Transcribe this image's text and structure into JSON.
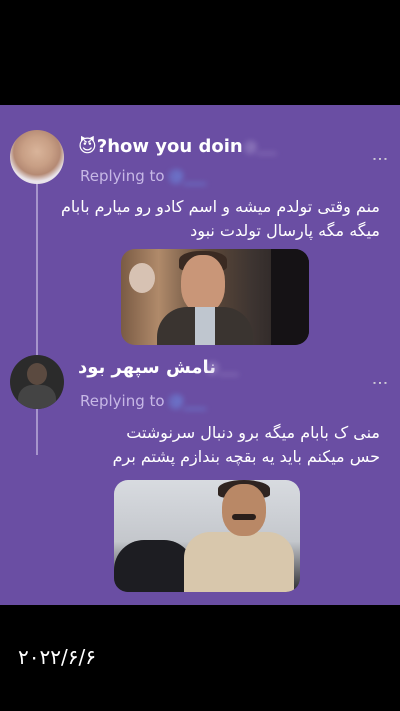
{
  "tweets": [
    {
      "name": "😈?how you doin",
      "handle": "@___",
      "reply_prefix": "Replying to",
      "reply_target": "@___",
      "text_line1": "منم وقتی تولدم میشه و اسم کادو رو میارم بابام",
      "text_line2": "میگه مگه پارسال تولدت نبود"
    },
    {
      "name": "نامش سپهر بود",
      "handle": "@___",
      "reply_prefix": "Replying to",
      "reply_target": "@___",
      "text_line1": "منی ک بابام میگه برو دنبال سرنوشتت",
      "text_line2": "حس میکنم باید یه بقچه بندازم پشتم برم"
    }
  ],
  "more_icon": "⋮",
  "date": "۲۰۲۲/۶/۶"
}
